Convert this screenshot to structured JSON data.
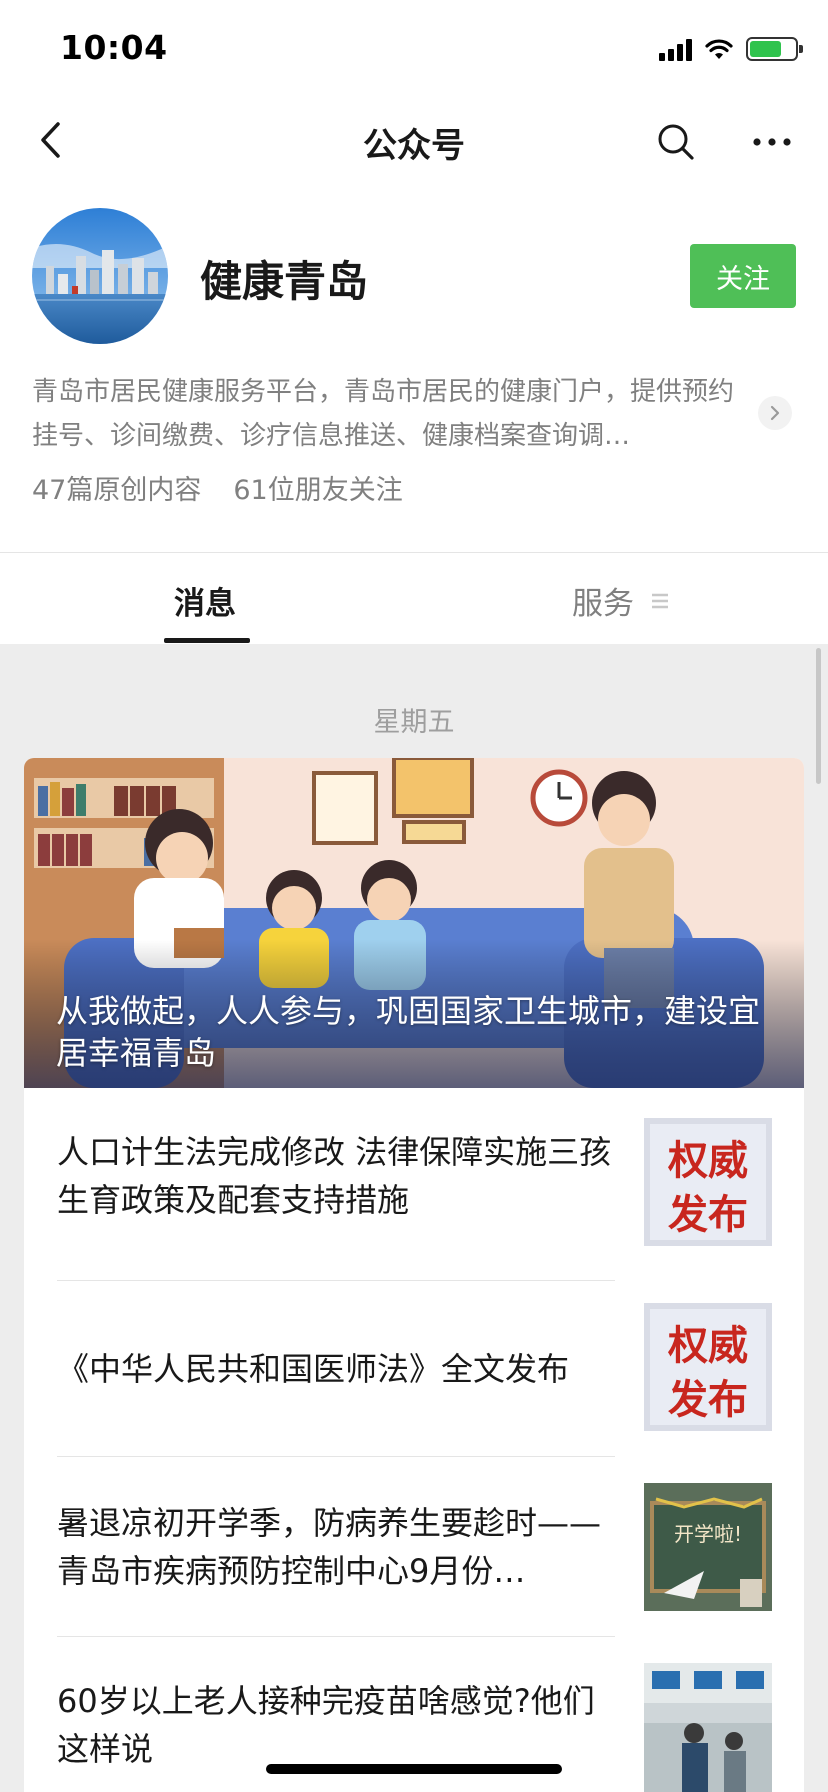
{
  "status_bar": {
    "time": "10:04"
  },
  "nav": {
    "title": "公众号",
    "back_icon": "back-chevron-icon",
    "search_icon": "search-icon",
    "more_icon": "more-icon"
  },
  "profile": {
    "name": "健康青岛",
    "follow_label": "关注",
    "description": "青岛市居民健康服务平台，青岛市居民的健康门户，提供预约挂号、诊间缴费、诊疗信息推送、健康档案查询调…",
    "original_count": "47篇原创内容",
    "friends_following": "61位朋友关注"
  },
  "tabs": {
    "messages": "消息",
    "services": "服务"
  },
  "feed": {
    "day": "星期五",
    "hero": {
      "title": "从我做起，人人参与，巩固国家卫生城市，建设宜居幸福青岛"
    },
    "articles": [
      {
        "title": "人口计生法完成修改 法律保障实施三孩生育政策及配套支持措施",
        "thumb_text": [
          "权威",
          "发布"
        ]
      },
      {
        "title": "《中华人民共和国医师法》全文发布",
        "thumb_text": [
          "权威",
          "发布"
        ]
      },
      {
        "title": "暑退凉初开学季，防病养生要趁时——青岛市疾病预防控制中心9月份…",
        "thumb_text": [
          "开学啦!"
        ]
      },
      {
        "title": "60岁以上老人接种完疫苗啥感觉?他们这样说"
      }
    ]
  },
  "colors": {
    "accent_green": "#4fbf57",
    "background": "#ededed"
  }
}
